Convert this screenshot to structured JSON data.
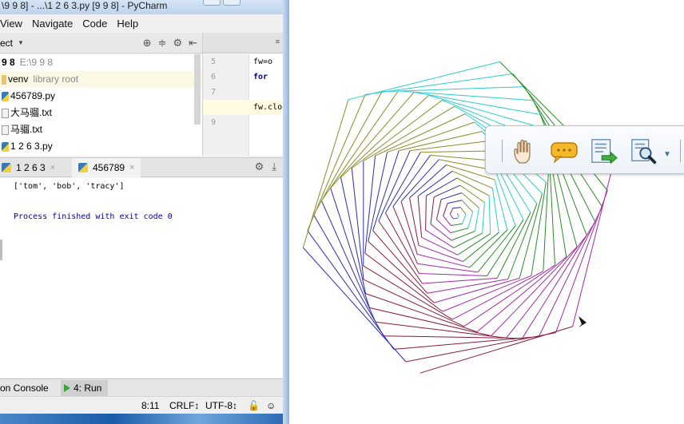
{
  "window": {
    "title": "\\9 9 8] - ...\\1 2 6 3.py [9 9 8] - PyCharm"
  },
  "menu": {
    "items": [
      "View",
      "Navigate",
      "Code",
      "Help"
    ]
  },
  "project_panel": {
    "header": "ect",
    "tree": [
      {
        "label": "9 8",
        "extra": "E:\\9 9 8",
        "type": "root"
      },
      {
        "label": "venv",
        "extra": "library root",
        "type": "folder"
      },
      {
        "label": "456789.py",
        "extra": "",
        "type": "py"
      },
      {
        "label": "大马骝.txt",
        "extra": "",
        "type": "txt"
      },
      {
        "label": "马骝.txt",
        "extra": "",
        "type": "txt"
      },
      {
        "label": "1 2 6 3.py",
        "extra": "",
        "type": "py"
      }
    ]
  },
  "editor": {
    "tab_button": "≡",
    "lines": [
      {
        "num": "5",
        "code": "fw=o"
      },
      {
        "num": "6",
        "code": "for "
      },
      {
        "num": "7",
        "code": ""
      },
      {
        "num": "8",
        "code": "fw.clo"
      },
      {
        "num": "9",
        "code": ""
      }
    ]
  },
  "run_panel": {
    "tabs": [
      {
        "label": "1 2 6 3",
        "close": "×"
      },
      {
        "label": "456789",
        "close": "×"
      }
    ],
    "output_line_1": "['tom', 'bob', 'tracy']",
    "output_line_2": "Process finished with exit code 0"
  },
  "bottom_tabs": {
    "console_label": "on Console",
    "run_label": "4: Run"
  },
  "status_bar": {
    "position": "8:11",
    "line_sep": "CRLF↕",
    "encoding": "UTF-8↕"
  },
  "colors": {
    "turtle_palette": [
      "#2b2bb5",
      "#8b8b2b",
      "#2bcccc",
      "#2b8b2b",
      "#a32ba3",
      "#8b1a3a"
    ]
  }
}
